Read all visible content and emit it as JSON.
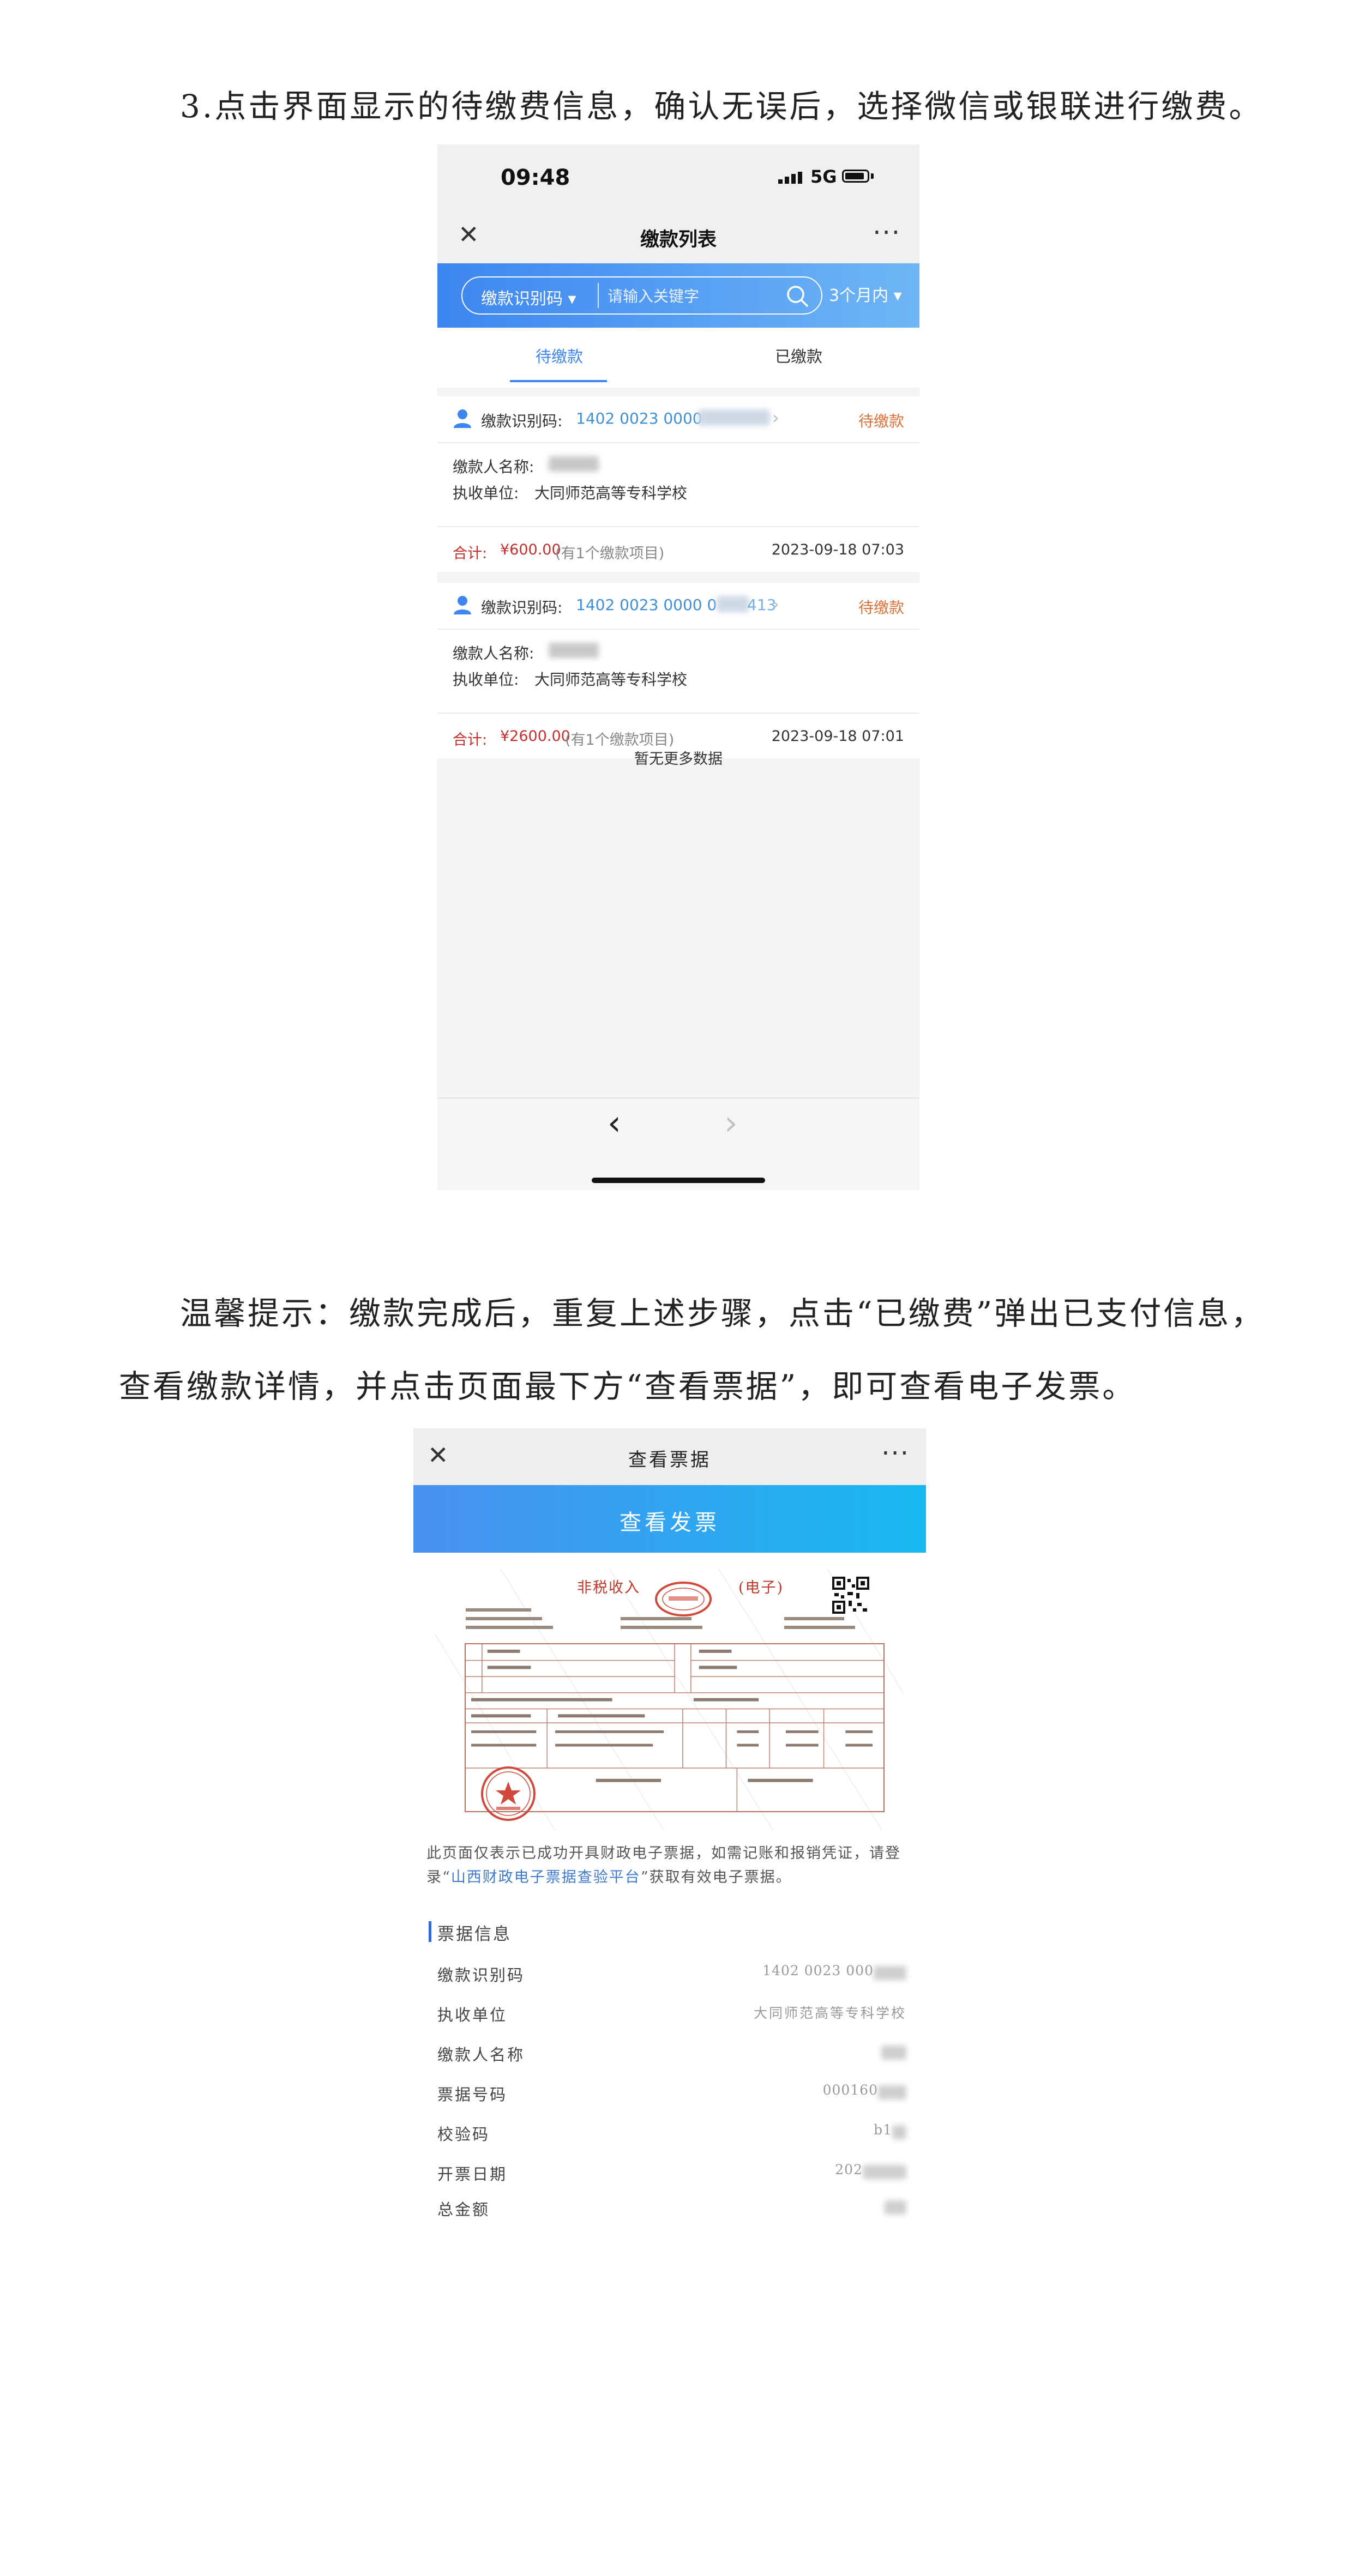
{
  "step3_text": "3.点击界面显示的待缴费信息，确认无误后，选择微信或银联进行缴费。",
  "phone1": {
    "status": {
      "time": "09:48",
      "network": "5G"
    },
    "title": "缴款列表",
    "search": {
      "type_label": "缴款识别码 ▾",
      "placeholder": "请输入关键字",
      "range_label": "3个月内 ▾"
    },
    "tabs": [
      "待缴款",
      "已缴款"
    ],
    "payments": [
      {
        "id_label": "缴款识别码:",
        "id_value": "1402 0023 0000",
        "status": "待缴款",
        "payer_label": "缴款人名称:",
        "unit_label": "执收单位:",
        "unit_value": "大同师范高等专科学校",
        "total_label": "合计:",
        "amount": "¥600.00",
        "items_note": "(有1个缴款项目)",
        "datetime": "2023-09-18 07:03"
      },
      {
        "id_label": "缴款识别码:",
        "id_value": "1402 0023 0000 0",
        "id_tail": "413",
        "status": "待缴款",
        "payer_label": "缴款人名称:",
        "unit_label": "执收单位:",
        "unit_value": "大同师范高等专科学校",
        "total_label": "合计:",
        "amount": "¥2600.00",
        "items_note": "(有1个缴款项目)",
        "datetime": "2023-09-18 07:01"
      }
    ],
    "no_more": "暂无更多数据"
  },
  "tip_line1": "温馨提示：缴款完成后，重复上述步骤，点击“已缴费”弹出已支付信息，",
  "tip_line2": "查看缴款详情，并点击页面最下方“查看票据”，即可查看电子发票。",
  "phone2": {
    "title": "查看票据",
    "header_button": "查看发票",
    "invoice_title": "非税收入",
    "invoice_title_suffix": "(电子)",
    "note_line1": "此页面仅表示已成功开具财政电子票据，如需记账和报销凭证，请登",
    "note_line2_pre": "录“",
    "note_link": "山西财政电子票据查验平台",
    "note_line2_post": "”获取有效电子票据。",
    "info_title": "票据信息",
    "info_rows": [
      {
        "label": "缴款识别码",
        "value": "1402 0023 000"
      },
      {
        "label": "执收单位",
        "value": "大同师范高等专科学校"
      },
      {
        "label": "缴款人名称",
        "value": ""
      },
      {
        "label": "票据号码",
        "value": "000160"
      },
      {
        "label": "校验码",
        "value": "b1"
      },
      {
        "label": "开票日期",
        "value": "202"
      },
      {
        "label": "总金额",
        "value": ""
      }
    ]
  }
}
